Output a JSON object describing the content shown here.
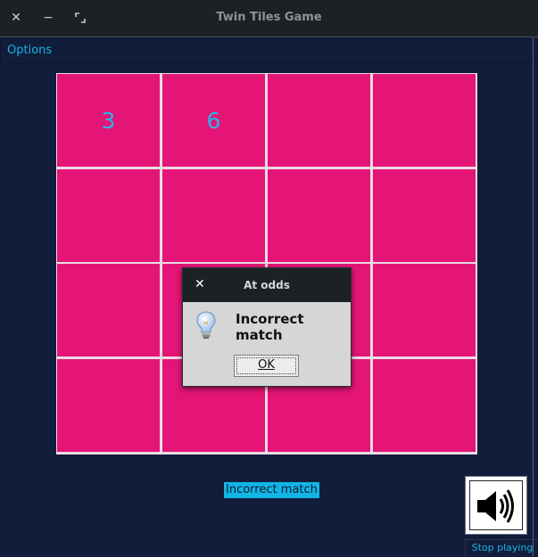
{
  "window": {
    "title": "Twin Tiles Game",
    "controls": [
      "close-icon",
      "minimize-icon",
      "maximize-icon"
    ]
  },
  "menu": {
    "options_label": "Options"
  },
  "board": {
    "rows": 4,
    "cols": 4,
    "tile_color": "#e41576",
    "number_color": "#29b6e8",
    "tiles": [
      [
        "3",
        "6",
        "",
        ""
      ],
      [
        "",
        "",
        "",
        ""
      ],
      [
        "",
        "",
        "",
        ""
      ],
      [
        "",
        "",
        "",
        ""
      ]
    ]
  },
  "status": {
    "message": "Incorrect match"
  },
  "sound": {
    "icon": "speaker-icon",
    "label": "Stop playing"
  },
  "dialog": {
    "title": "At odds",
    "message": "Incorrect match",
    "icon": "lightbulb-icon",
    "ok_label": "OK"
  },
  "colors": {
    "background": "#111d3a",
    "accent": "#1ab2e6",
    "titlebar": "#1c2126"
  }
}
